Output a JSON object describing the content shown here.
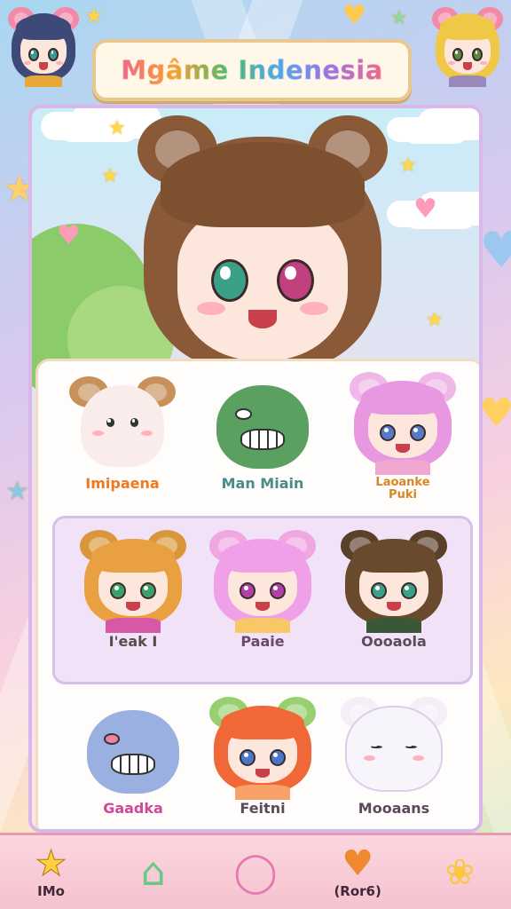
{
  "title": "Mgâme Indenesia",
  "colors": {
    "accent_pink": "#f06888",
    "frame_border": "#d8b8e8",
    "highlight_row": "#f1e2f8",
    "nav_bg": "#f6c2cf"
  },
  "characters": [
    {
      "name": "Imipaena",
      "color": "#f07820",
      "kind": "bear-creature",
      "icon": "bear-face-icon"
    },
    {
      "name": "Man Miain",
      "color": "#4a8a88",
      "kind": "green-monster",
      "icon": "monster-icon"
    },
    {
      "name": "Laoanke\nPuki",
      "color": "#d88820",
      "kind": "pink-girl",
      "icon": "girl-icon"
    },
    {
      "name": "I'eak I",
      "color": "#5a4a4a",
      "kind": "blonde-girl",
      "icon": "girl-icon"
    },
    {
      "name": "Paaie",
      "color": "#6a4a6a",
      "kind": "pink-girl",
      "icon": "girl-icon"
    },
    {
      "name": "Oooaola",
      "color": "#5a4a5a",
      "kind": "brown-girl",
      "icon": "girl-icon"
    },
    {
      "name": "Gaadka",
      "color": "#d04898",
      "kind": "blue-monster",
      "icon": "monster-icon"
    },
    {
      "name": "Feitni",
      "color": "#5a4a5a",
      "kind": "red-girl",
      "icon": "girl-icon"
    },
    {
      "name": "Mooaans",
      "color": "#5a4a5a",
      "kind": "ghost",
      "icon": "ghost-icon"
    }
  ],
  "nav": [
    {
      "label": "IMo",
      "icon": "star-icon"
    },
    {
      "label": "",
      "icon": "home-icon"
    },
    {
      "label": "",
      "icon": "ring-icon"
    },
    {
      "label": "(Ror6)",
      "icon": "heart-icon"
    },
    {
      "label": "",
      "icon": "bird-icon"
    }
  ]
}
